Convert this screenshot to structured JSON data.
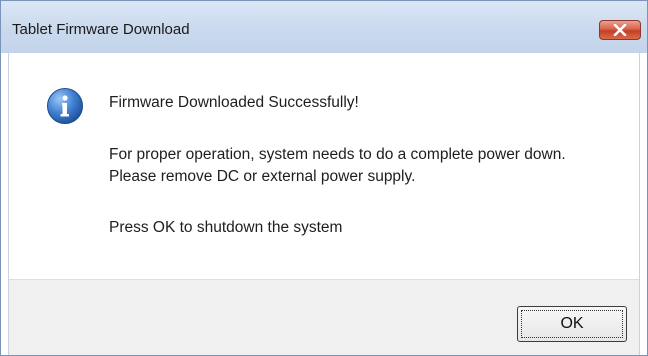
{
  "window": {
    "title": "Tablet Firmware Download",
    "close_icon": "close-icon"
  },
  "message": {
    "icon": "info-icon",
    "line1": "Firmware Downloaded Successfully!",
    "line2": "For proper operation, system needs to do a complete power down. Please remove DC or external power supply.",
    "line3": "Press OK to shutdown the system"
  },
  "buttons": {
    "ok_label": "OK"
  },
  "colors": {
    "close_button": "#c94a2f",
    "info_icon": "#2f6fc4",
    "titlebar": "#cad9ee"
  }
}
